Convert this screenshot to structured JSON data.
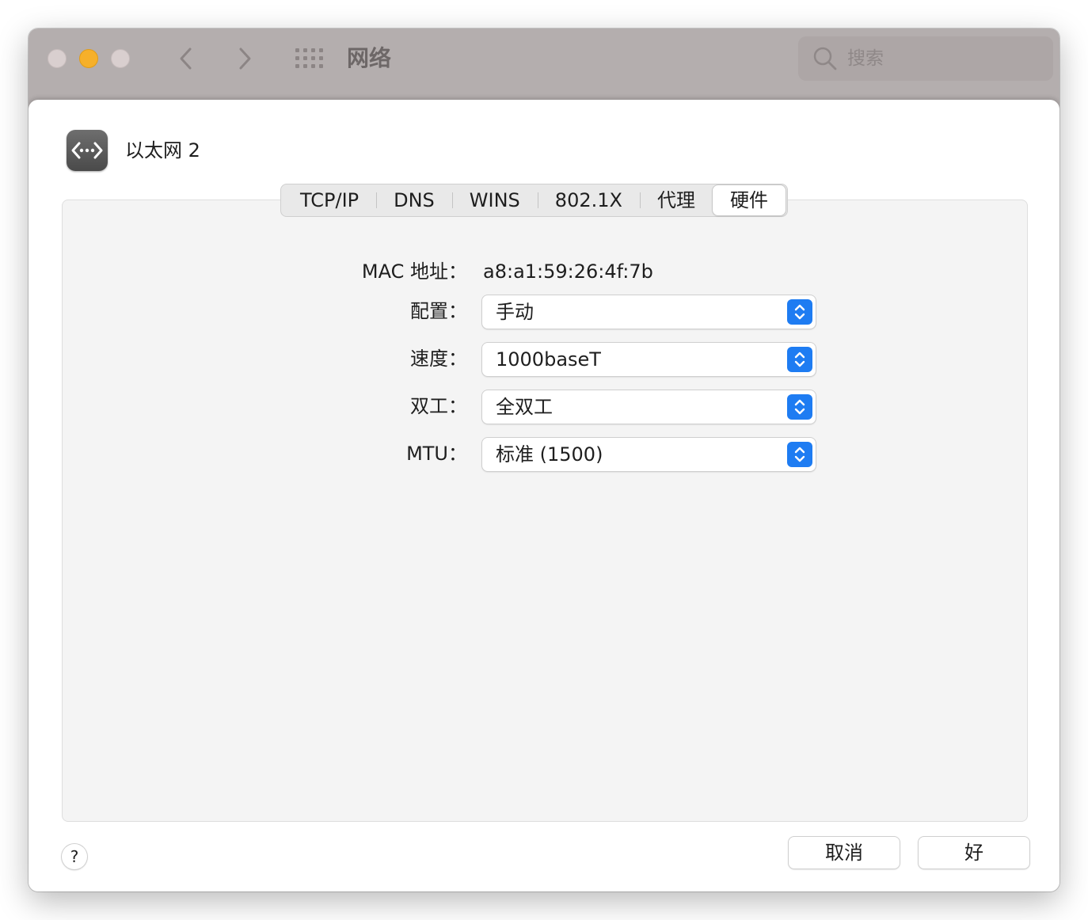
{
  "window": {
    "title": "网络",
    "search_placeholder": "搜索"
  },
  "interface": {
    "name": "以太网 2",
    "icon": "ethernet-icon"
  },
  "tabs": [
    {
      "label": "TCP/IP",
      "selected": false
    },
    {
      "label": "DNS",
      "selected": false
    },
    {
      "label": "WINS",
      "selected": false
    },
    {
      "label": "802.1X",
      "selected": false
    },
    {
      "label": "代理",
      "selected": false
    },
    {
      "label": "硬件",
      "selected": true
    }
  ],
  "hardware": {
    "mac_label": "MAC 地址：",
    "mac_value": "a8:a1:59:26:4f:7b",
    "config_label": "配置：",
    "config_value": "手动",
    "speed_label": "速度：",
    "speed_value": "1000baseT",
    "duplex_label": "双工：",
    "duplex_value": "全双工",
    "mtu_label": "MTU：",
    "mtu_value": "标准 (1500)"
  },
  "buttons": {
    "help": "?",
    "cancel": "取消",
    "ok": "好"
  },
  "colors": {
    "accent": "#1e7cf2",
    "titlebar": "#b4aeae",
    "close": "#d9cfcf",
    "minimize": "#f6b02a"
  }
}
